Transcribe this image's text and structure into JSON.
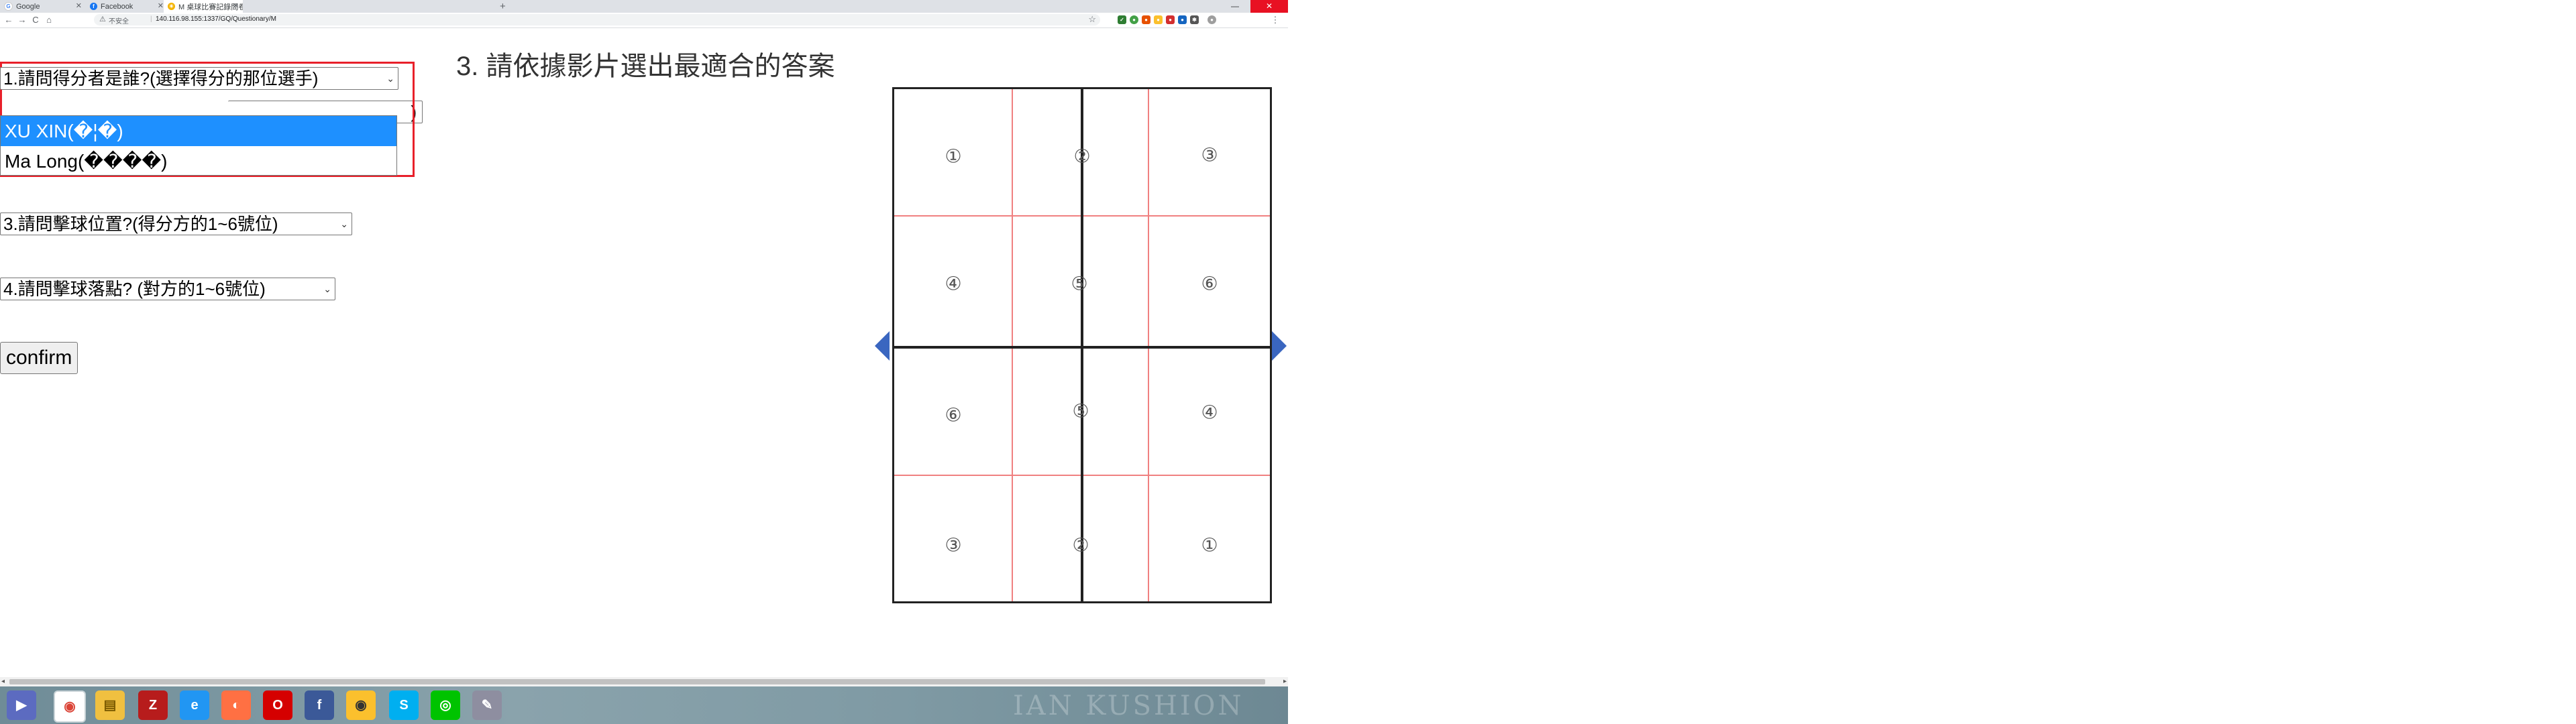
{
  "browser": {
    "tabs": [
      {
        "title": "Google",
        "icon": "google-icon",
        "active": false
      },
      {
        "title": "Facebook",
        "icon": "facebook-icon",
        "active": false
      },
      {
        "title": "M 桌球比賽記錄問卷意見表",
        "icon": "sun-icon",
        "active": true
      }
    ],
    "new_tab": "+",
    "min_button": "—",
    "close_button": "✕",
    "nav": {
      "back": "←",
      "forward": "→",
      "reload": "C",
      "home": "⌂"
    },
    "address": {
      "security_icon": "warning-icon",
      "security_label": "不安全",
      "separator": "|",
      "url": "140.116.98.155:1337/GQ/Questionary/M"
    },
    "bookmark_star": "☆",
    "menu": "⋮"
  },
  "form": {
    "q1": {
      "label": "1.請問得分者是誰?(選擇得分的那位選手)",
      "options": [
        "XU XIN(�¦�)",
        "Ma Long(����)"
      ],
      "highlighted_option": 0
    },
    "q2_partial": ")",
    "q3": {
      "label": "3.請問擊球位置?(得分方的1~6號位)"
    },
    "q4": {
      "label": "4.請問擊球落點? (對方的1~6號位)"
    },
    "confirm_label": "confirm",
    "caret": "⌄"
  },
  "instruction": "3. 請依據影片選出最適合的答案",
  "court": {
    "top_zones": [
      "①",
      "②",
      "③",
      "④",
      "⑤",
      "⑥"
    ],
    "bottom_zones": [
      "⑥",
      "⑤",
      "④",
      "③",
      "②",
      "①"
    ],
    "net_color": "#3a66c0",
    "grid_color": "#f08080"
  },
  "taskbar": {
    "apps": [
      "media-player-icon",
      "chrome-icon",
      "file-explorer-icon",
      "filezilla-icon",
      "edge-icon",
      "firefox-icon",
      "opera-icon",
      "facebook-icon",
      "chrome-canary-icon",
      "skype-icon",
      "line-icon",
      "paint-icon"
    ],
    "wallpaper_text": "IAN KUSHION"
  },
  "colors": {
    "highlight": "#1e90ff",
    "box_border": "#e8202a"
  }
}
